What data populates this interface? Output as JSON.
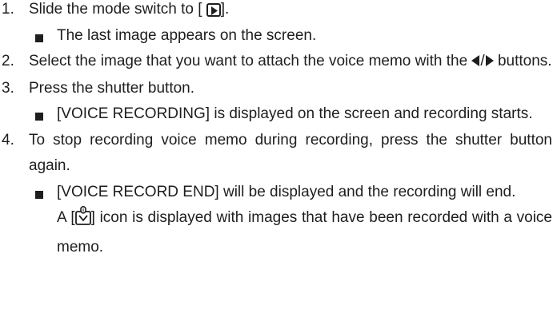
{
  "steps": [
    {
      "number": "1.",
      "text_before_icon": "Slide the mode switch to [",
      "icon": "playback-icon",
      "text_after_icon": "].",
      "bullets": [
        "The last image appears on the screen."
      ]
    },
    {
      "number": "2.",
      "text_before_icon": "Select the image that you want to attach the voice memo with the",
      "icon_pair": [
        "left-arrow-icon",
        "right-arrow-icon"
      ],
      "icon_separator": "/",
      "text_after_icon": "buttons.",
      "bullets": []
    },
    {
      "number": "3.",
      "text": "Press the shutter button.",
      "bullets": [
        "[VOICE RECORDING] is displayed on the screen and recording starts."
      ]
    },
    {
      "number": "4.",
      "text": "To stop recording voice memo during recording, press the shutter button again.",
      "bullets": [
        "[VOICE RECORD END] will be displayed and the recording will end."
      ],
      "note_before_icon": "A [",
      "note_icon": "voice-memo-icon",
      "note_after_icon": "] icon is displayed with images that have been recorded with a voice memo."
    }
  ]
}
